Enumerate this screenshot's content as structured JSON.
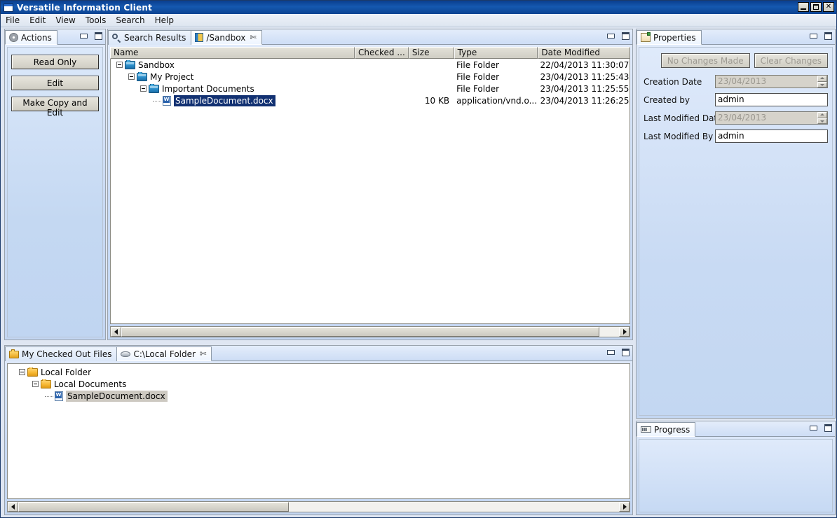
{
  "window": {
    "title": "Versatile Information Client",
    "icon": "app-window-icon",
    "controls": {
      "minimize": "_",
      "maximize": "□",
      "close": "✕"
    }
  },
  "menubar": {
    "items": [
      "File",
      "Edit",
      "View",
      "Tools",
      "Search",
      "Help"
    ]
  },
  "actions_panel": {
    "tab_label": "Actions",
    "tab_icon": "gear-icon",
    "buttons": [
      "Read Only",
      "Edit",
      "Make Copy and Edit"
    ]
  },
  "browser_panel": {
    "tabs": [
      {
        "label": "Search Results",
        "icon": "search-icon",
        "active": false,
        "closable": false
      },
      {
        "label": "/Sandbox",
        "icon": "repository-icon",
        "active": true,
        "closable": true,
        "close_glyph": "✄"
      }
    ],
    "columns": [
      "Name",
      "Checked ...",
      "Size",
      "Type",
      "Date Modified"
    ],
    "rows": [
      {
        "name": "Sandbox",
        "indent": 0,
        "icon": "folder-blue-icon",
        "expander": "minus",
        "checked_out": "",
        "size": "",
        "type": "File Folder",
        "date_modified": "22/04/2013 11:30:07",
        "selected": false
      },
      {
        "name": "My Project",
        "indent": 1,
        "icon": "folder-blue-icon",
        "expander": "minus",
        "checked_out": "",
        "size": "",
        "type": "File Folder",
        "date_modified": "23/04/2013 11:25:43",
        "selected": false
      },
      {
        "name": "Important Documents",
        "indent": 2,
        "icon": "folder-blue-icon",
        "expander": "minus",
        "checked_out": "",
        "size": "",
        "type": "File Folder",
        "date_modified": "23/04/2013 11:25:55",
        "selected": false
      },
      {
        "name": "SampleDocument.docx",
        "indent": 3,
        "icon": "word-document-icon",
        "expander": "none",
        "checked_out": "",
        "size": "10 KB",
        "type": "application/vnd.o...",
        "date_modified": "23/04/2013 11:26:25",
        "selected": true
      }
    ]
  },
  "properties_panel": {
    "tab_label": "Properties",
    "tab_icon": "properties-icon",
    "buttons": [
      {
        "label": "No Changes Made",
        "enabled": false
      },
      {
        "label": "Clear Changes",
        "enabled": false
      }
    ],
    "fields": [
      {
        "label": "Creation Date",
        "value": "23/04/2013",
        "kind": "spinner",
        "disabled": true
      },
      {
        "label": "Created by",
        "value": "admin",
        "kind": "text",
        "disabled": false
      },
      {
        "label": "Last Modified Date",
        "value": "23/04/2013",
        "kind": "spinner",
        "disabled": true
      },
      {
        "label": "Last Modified By",
        "value": "admin",
        "kind": "text",
        "disabled": false
      }
    ]
  },
  "local_panel": {
    "tabs": [
      {
        "label": "My Checked Out Files",
        "icon": "checked-out-folder-icon",
        "active": false,
        "closable": false
      },
      {
        "label": "C:\\Local Folder",
        "icon": "drive-icon",
        "active": true,
        "closable": true,
        "close_glyph": "✄"
      }
    ],
    "rows": [
      {
        "name": "Local Folder",
        "indent": 0,
        "icon": "folder-yellow-icon",
        "expander": "minus",
        "selected": false
      },
      {
        "name": "Local Documents",
        "indent": 1,
        "icon": "folder-yellow-icon",
        "expander": "minus",
        "selected": false
      },
      {
        "name": "SampleDocument.docx",
        "indent": 2,
        "icon": "word-document-icon",
        "expander": "none",
        "selected": true
      }
    ]
  },
  "progress_panel": {
    "tab_label": "Progress",
    "tab_icon": "progress-icon",
    "content": ""
  },
  "colors": {
    "titlebar": "#1558b0",
    "panel_blue": "#c9daf3",
    "selection_blue": "#123172",
    "selection_gray": "#cdc9c1",
    "header_gray": "#d6d4cb"
  }
}
